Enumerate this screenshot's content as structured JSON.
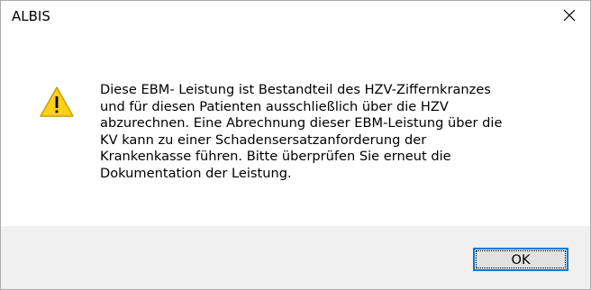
{
  "window": {
    "title": "ALBIS",
    "close_icon": "close-icon"
  },
  "message": {
    "icon": "warning-icon",
    "lines": [
      "Diese EBM- Leistung ist Bestandteil des HZV-Ziffernkranzes",
      "und für diesen Patienten ausschließlich über die HZV",
      "abzurechnen. Eine Abrechnung dieser EBM-Leistung über die",
      "KV kann zu einer Schadensersatzanforderung der",
      "Krankenkasse führen. Bitte überprüfen Sie erneut die",
      "Dokumentation der Leistung."
    ]
  },
  "buttons": {
    "ok_label": "OK"
  },
  "colors": {
    "warning_fill": "#fcd116",
    "warning_border": "#c9a000",
    "focus_border": "#0078d7",
    "footer_bg": "#f0f0f0"
  }
}
